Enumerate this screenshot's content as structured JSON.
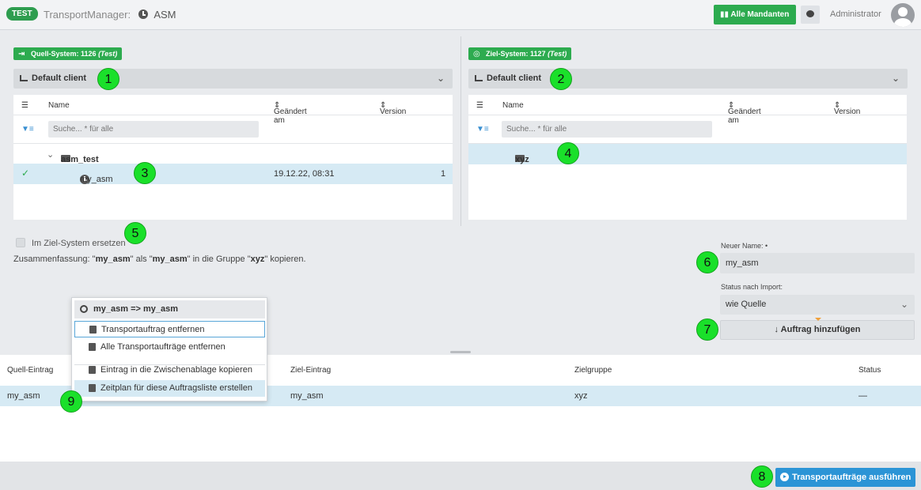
{
  "header": {
    "env_badge": "TEST",
    "app_title": "TransportManager:",
    "app_subtitle": "ASM",
    "all_clients_button": "Alle Mandanten",
    "user": "Administrator"
  },
  "source": {
    "badge": "Quell-System: 1126",
    "badge_suffix": "(Test)",
    "client": "Default client",
    "columns": {
      "name": "Name",
      "changed": "Geändert am",
      "version": "Version"
    },
    "search_placeholder": "Suche... * für alle",
    "folder": "asm_test",
    "item": {
      "name": "my_asm",
      "changed": "19.12.22, 08:31",
      "version": "1"
    }
  },
  "target": {
    "badge": "Ziel-System: 1127",
    "badge_suffix": "(Test)",
    "client": "Default client",
    "columns": {
      "name": "Name",
      "changed": "Geändert am",
      "version": "Version"
    },
    "search_placeholder": "Suche... * für alle",
    "folder": "xyz"
  },
  "options": {
    "replace_label": "Im Ziel-System ersetzen",
    "summary_prefix": "Zusammenfassung: \"",
    "summary_src": "my_asm",
    "summary_mid1": "\" als \"",
    "summary_new": "my_asm",
    "summary_mid2": "\" in die Gruppe \"",
    "summary_group": "xyz",
    "summary_suffix": "\" kopieren."
  },
  "form": {
    "new_name_label": "Neuer Name: •",
    "new_name_value": "my_asm",
    "status_label": "Status nach Import:",
    "status_value": "wie Quelle",
    "add_button": "↓ Auftrag hinzufügen"
  },
  "orders": {
    "columns": {
      "source": "Quell-Eintrag",
      "target": "Ziel-Eintrag",
      "group": "Zielgruppe",
      "status": "Status"
    },
    "row": {
      "source": "my_asm",
      "target": "my_asm",
      "group": "xyz",
      "status": "—"
    }
  },
  "context_menu": {
    "title": "my_asm => my_asm",
    "items": [
      "Transportauftrag entfernen",
      "Alle Transportaufträge entfernen",
      "Eintrag in die Zwischenablage kopieren",
      "Zeitplan für diese Auftragsliste erstellen"
    ]
  },
  "footer": {
    "run_button": "Transportaufträge ausführen"
  },
  "callouts": [
    "1",
    "2",
    "3",
    "4",
    "5",
    "6",
    "7",
    "8",
    "9"
  ],
  "colors": {
    "green": "#2dab4f",
    "blue": "#2b94d6",
    "callout": "#1ae02a",
    "selection": "#d6eaf4"
  }
}
